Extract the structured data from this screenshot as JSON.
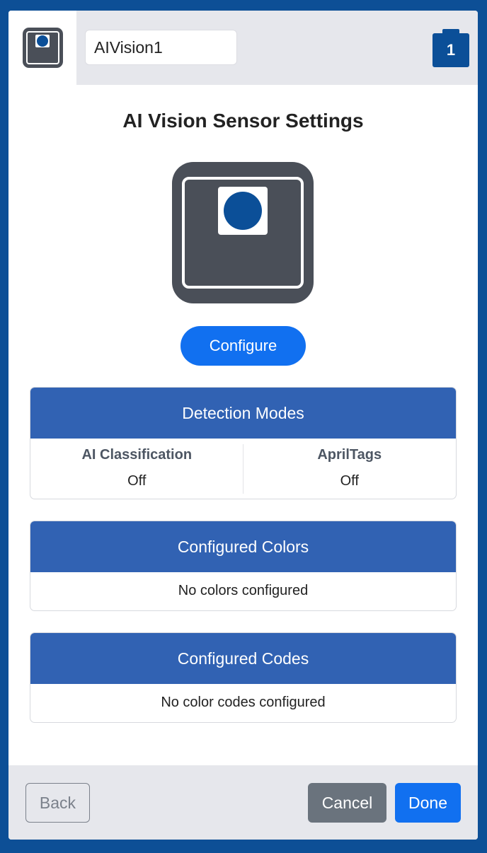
{
  "header": {
    "device_icon": "ai-vision-sensor-icon",
    "name_value": "AIVision1",
    "port_number": "1"
  },
  "main": {
    "title": "AI Vision Sensor Settings",
    "configure_label": "Configure",
    "detection_modes": {
      "title": "Detection Modes",
      "modes": [
        {
          "label": "AI Classification",
          "value": "Off"
        },
        {
          "label": "AprilTags",
          "value": "Off"
        }
      ]
    },
    "configured_colors": {
      "title": "Configured Colors",
      "empty_text": "No colors configured"
    },
    "configured_codes": {
      "title": "Configured Codes",
      "empty_text": "No color codes configured"
    }
  },
  "footer": {
    "back_label": "Back",
    "cancel_label": "Cancel",
    "done_label": "Done"
  },
  "colors": {
    "primary": "#1170f0",
    "card_header": "#3162b3",
    "brand_blue": "#0b4f98",
    "sensor_gray": "#4a4f58"
  }
}
